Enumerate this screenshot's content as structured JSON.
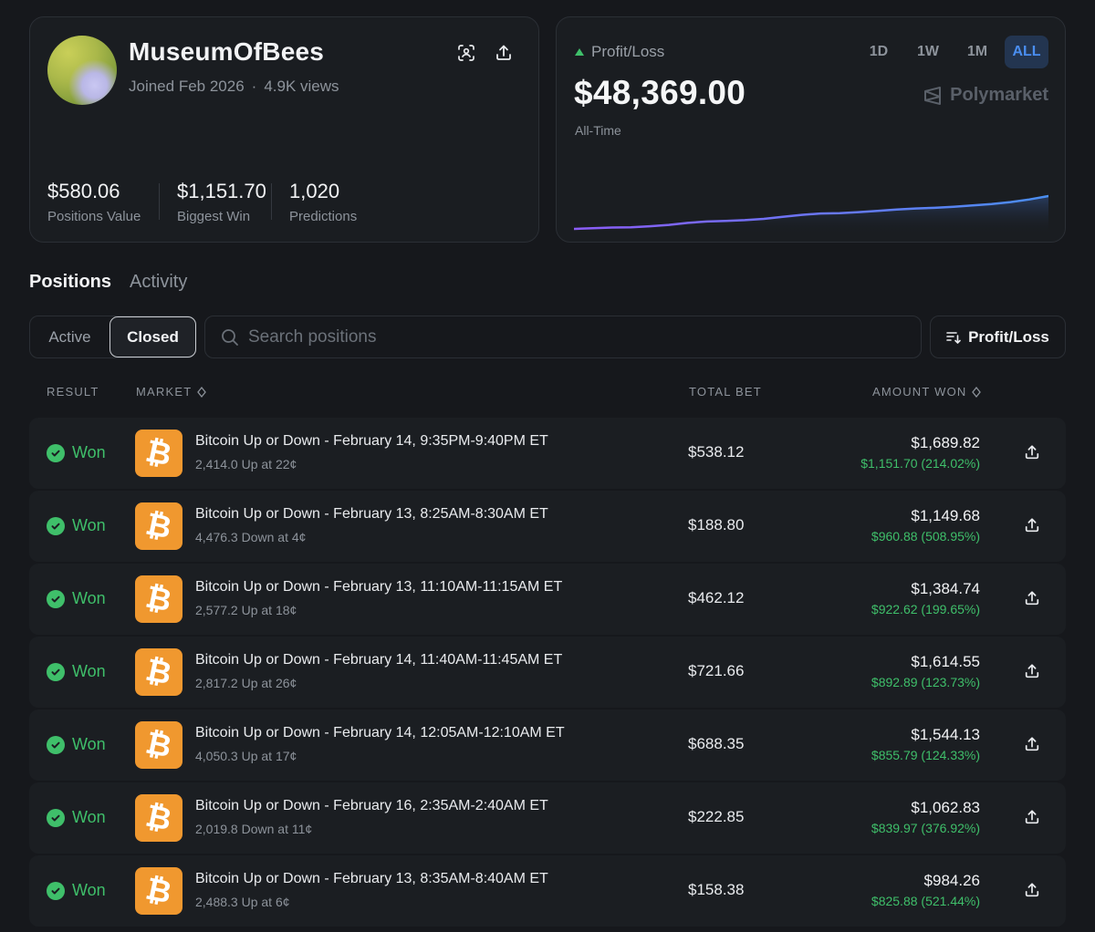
{
  "profile": {
    "username": "MuseumOfBees",
    "joined": "Joined Feb 2026",
    "views": "4.9K views",
    "stats": [
      {
        "value": "$580.06",
        "label": "Positions Value"
      },
      {
        "value": "$1,151.70",
        "label": "Biggest Win"
      },
      {
        "value": "1,020",
        "label": "Predictions"
      }
    ]
  },
  "pnl": {
    "label": "Profit/Loss",
    "value": "$48,369.00",
    "period_label": "All-Time",
    "brand": "Polymarket",
    "ranges": [
      "1D",
      "1W",
      "1M",
      "ALL"
    ],
    "active_range": "ALL",
    "trend": [
      5,
      6,
      7,
      7.5,
      9,
      11,
      14,
      16,
      17,
      18,
      20,
      23,
      26,
      28,
      28.5,
      30,
      32,
      34,
      35.5,
      36.5,
      38,
      40,
      42,
      45,
      49,
      54
    ]
  },
  "tabs": [
    "Positions",
    "Activity"
  ],
  "filter": {
    "segments": [
      "Active",
      "Closed"
    ],
    "selected": "Closed",
    "search_placeholder": "Search positions",
    "sort_label": "Profit/Loss"
  },
  "table": {
    "headers": {
      "result": "RESULT",
      "market": "MARKET",
      "total_bet": "TOTAL BET",
      "amount_won": "AMOUNT WON"
    },
    "rows": [
      {
        "result": "Won",
        "title": "Bitcoin Up or Down - February 14, 9:35PM-9:40PM ET",
        "detail": "2,414.0 Up at 22¢",
        "bet": "$538.12",
        "won": "$1,689.82",
        "gain": "$1,151.70 (214.02%)"
      },
      {
        "result": "Won",
        "title": "Bitcoin Up or Down - February 13, 8:25AM-8:30AM ET",
        "detail": "4,476.3 Down at 4¢",
        "bet": "$188.80",
        "won": "$1,149.68",
        "gain": "$960.88 (508.95%)"
      },
      {
        "result": "Won",
        "title": "Bitcoin Up or Down - February 13, 11:10AM-11:15AM ET",
        "detail": "2,577.2 Up at 18¢",
        "bet": "$462.12",
        "won": "$1,384.74",
        "gain": "$922.62 (199.65%)"
      },
      {
        "result": "Won",
        "title": "Bitcoin Up or Down - February 14, 11:40AM-11:45AM ET",
        "detail": "2,817.2 Up at 26¢",
        "bet": "$721.66",
        "won": "$1,614.55",
        "gain": "$892.89 (123.73%)"
      },
      {
        "result": "Won",
        "title": "Bitcoin Up or Down - February 14, 12:05AM-12:10AM ET",
        "detail": "4,050.3 Up at 17¢",
        "bet": "$688.35",
        "won": "$1,544.13",
        "gain": "$855.79 (124.33%)"
      },
      {
        "result": "Won",
        "title": "Bitcoin Up or Down - February 16, 2:35AM-2:40AM ET",
        "detail": "2,019.8 Down at 11¢",
        "bet": "$222.85",
        "won": "$1,062.83",
        "gain": "$839.97 (376.92%)"
      },
      {
        "result": "Won",
        "title": "Bitcoin Up or Down - February 13, 8:35AM-8:40AM ET",
        "detail": "2,488.3 Up at 6¢",
        "bet": "$158.38",
        "won": "$984.26",
        "gain": "$825.88 (521.44%)"
      }
    ]
  },
  "colors": {
    "win": "#3fbf6a",
    "btc": "#f0982f",
    "accent": "#4a8ef0",
    "line_start": "#8b5cf6",
    "line_end": "#4a8ef0"
  },
  "icons": {
    "scan": "scan-face-icon",
    "share": "share-icon",
    "check": "check-circle-icon",
    "bitcoin": "bitcoin-icon",
    "search": "search-icon",
    "sort": "sort-icon",
    "sort_toggle": "diamond-sort-icon",
    "brand": "polymarket-logo-icon",
    "trend": "triangle-up-icon"
  }
}
